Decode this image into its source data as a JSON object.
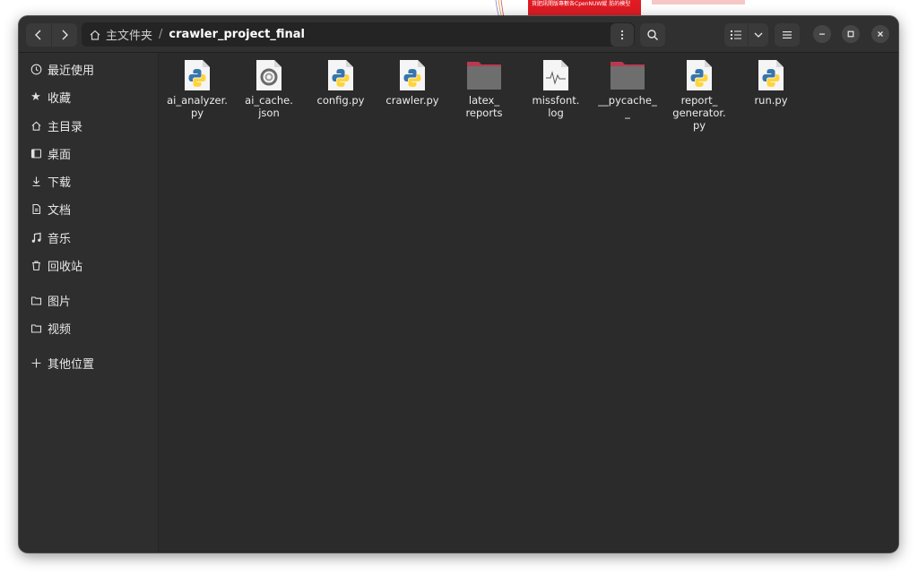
{
  "background": {
    "red_note_text": "貨肥訊開版專數各CpenNUW縱 肪的模型"
  },
  "header": {
    "breadcrumb_home": "主文件夹",
    "breadcrumb_separator": "/",
    "breadcrumb_current": "crawler_project_final"
  },
  "sidebar": {
    "items": [
      {
        "label": "最近使用",
        "icon": "clock-icon"
      },
      {
        "label": "收藏",
        "icon": "star-icon"
      },
      {
        "label": "主目录",
        "icon": "home-icon"
      },
      {
        "label": "桌面",
        "icon": "desktop-icon"
      },
      {
        "label": "下载",
        "icon": "download-icon"
      },
      {
        "label": "文档",
        "icon": "document-icon"
      },
      {
        "label": "音乐",
        "icon": "music-icon"
      },
      {
        "label": "回收站",
        "icon": "trash-icon"
      },
      {
        "label": "图片",
        "icon": "folder-icon"
      },
      {
        "label": "视频",
        "icon": "folder-icon"
      },
      {
        "label": "其他位置",
        "icon": "plus-icon"
      }
    ]
  },
  "files": [
    {
      "name": "ai_analyzer.\npy",
      "type": "python"
    },
    {
      "name": "ai_cache.\njson",
      "type": "json"
    },
    {
      "name": "config.py",
      "type": "python"
    },
    {
      "name": "crawler.py",
      "type": "python"
    },
    {
      "name": "latex_\nreports",
      "type": "folder"
    },
    {
      "name": "missfont.\nlog",
      "type": "log"
    },
    {
      "name": "__pycache_\n_",
      "type": "folder"
    },
    {
      "name": "report_\ngenerator.\npy",
      "type": "python"
    },
    {
      "name": "run.py",
      "type": "python"
    }
  ],
  "colors": {
    "window_bg": "#2b2b2b",
    "sidebar_bg": "#2e2e2e",
    "folder": "#6e6e6e",
    "folder_tab": "#c0405a",
    "python_blue": "#3776ab",
    "python_yellow": "#ffd43b"
  }
}
